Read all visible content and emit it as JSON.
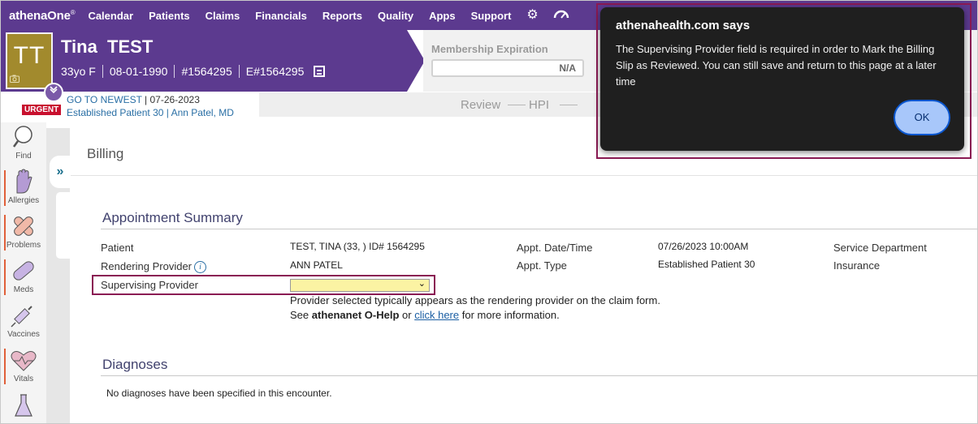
{
  "nav": {
    "logo": "athenaOne",
    "logo_mark": "®",
    "items": [
      "Calendar",
      "Patients",
      "Claims",
      "Financials",
      "Reports",
      "Quality",
      "Apps",
      "Support"
    ],
    "settings_icon": "gear-icon",
    "dashboard_icon": "speedometer-icon"
  },
  "patient": {
    "initials": "TT",
    "name": "Tina  TEST",
    "age_sex": "33yo F",
    "dob": "08-01-1990",
    "id": "#1564295",
    "enterprise_id": "E#1564295"
  },
  "membership": {
    "label": "Membership Expiration",
    "value": "N/A"
  },
  "encounter": {
    "urgent_label": "URGENT",
    "go_to_newest": "GO TO NEWEST",
    "date": "07-26-2023",
    "type": "Established Patient 30",
    "provider": "Ann Patel, MD",
    "tabs": [
      "Review",
      "HPI"
    ]
  },
  "sidebar": {
    "items": [
      {
        "label": "Find",
        "icon": "magnifier-icon"
      },
      {
        "label": "Allergies",
        "icon": "hand-icon"
      },
      {
        "label": "Problems",
        "icon": "bandage-icon"
      },
      {
        "label": "Meds",
        "icon": "pill-icon"
      },
      {
        "label": "Vaccines",
        "icon": "syringe-icon"
      },
      {
        "label": "Vitals",
        "icon": "heart-pulse-icon"
      }
    ]
  },
  "billing": {
    "title": "Billing",
    "appointment_summary": {
      "title": "Appointment Summary",
      "patient_label": "Patient",
      "patient_value": "TEST, TINA (33, ) ID# 1564295",
      "rendering_label": "Rendering Provider",
      "rendering_value": "ANN PATEL",
      "supervising_label": "Supervising Provider",
      "supervising_value": "",
      "appt_datetime_label": "Appt. Date/Time",
      "appt_datetime_value": "07/26/2023 10:00AM",
      "appt_type_label": "Appt. Type",
      "appt_type_value": "Established Patient 30",
      "service_dept_label": "Service Department",
      "insurance_label": "Insurance",
      "help_line1": "Provider selected typically appears as the rendering provider on the claim form.",
      "help_see": "See",
      "help_link1": "athenanet O-Help",
      "help_or": "or",
      "help_link2": "click here",
      "help_tail": "for more information."
    },
    "diagnoses": {
      "title": "Diagnoses",
      "empty_text": "No diagnoses have been specified in this encounter."
    }
  },
  "dialog": {
    "title": "athenahealth.com says",
    "message": "The Supervising Provider field is required in order to Mark the Billing Slip as Reviewed. You can still save and return to this page at a later time",
    "ok_label": "OK"
  }
}
